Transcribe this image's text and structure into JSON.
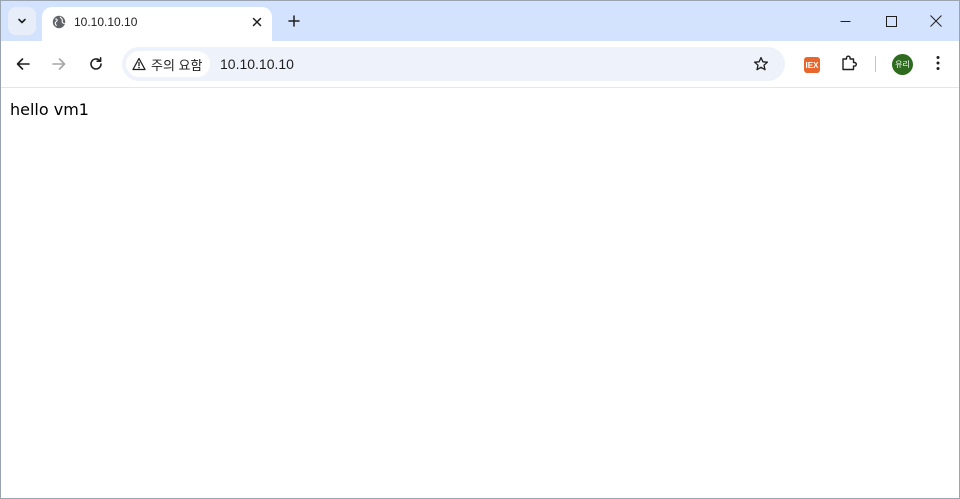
{
  "tab": {
    "title": "10.10.10.10",
    "favicon": "globe-icon"
  },
  "toolbar": {
    "security_label": "주의 요함",
    "url": "10.10.10.10"
  },
  "profile": {
    "avatar_text": "유리",
    "avatar_color": "#2e6b1f"
  },
  "extension": {
    "label": "IEX",
    "color": "#e8662c"
  },
  "page": {
    "body_text": "hello vm1"
  },
  "colors": {
    "tabstrip": "#d3e3fd",
    "omnibox": "#eef2fa"
  }
}
